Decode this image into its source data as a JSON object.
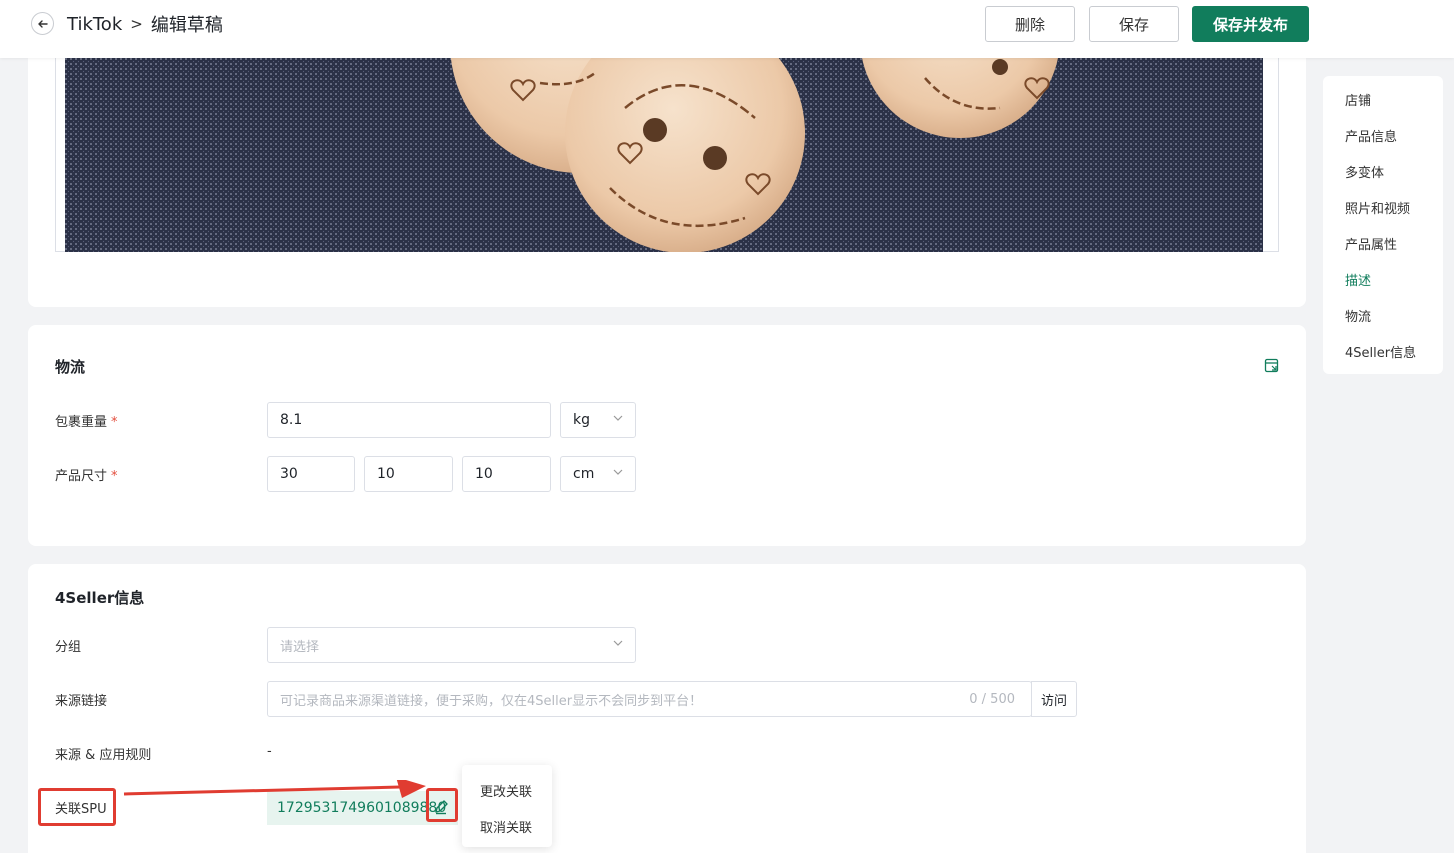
{
  "header": {
    "back_icon": "arrow-left-icon",
    "platform": "TikTok",
    "separator": ">",
    "page_title": "编辑草稿",
    "delete_label": "删除",
    "save_label": "保存",
    "save_publish_label": "保存并发布"
  },
  "logistics": {
    "title": "物流",
    "weight_label": "包裹重量",
    "weight_value": "8.1",
    "weight_unit": "kg",
    "dimension_label": "产品尺寸",
    "length": "30",
    "width": "10",
    "height": "10",
    "dimension_unit": "cm",
    "required_mark": "*"
  },
  "seller_info": {
    "title": "4Seller信息",
    "group_label": "分组",
    "group_placeholder": "请选择",
    "source_link_label": "来源链接",
    "source_link_placeholder": "可记录商品来源渠道链接，便于采购，仅在4Seller显示不会同步到平台！",
    "source_link_count": "0 / 500",
    "visit_label": "访问",
    "source_rule_label": "来源 & 应用规则",
    "source_rule_value": "-",
    "spu_label": "关联SPU",
    "spu_value": "1729531749601089880",
    "spu_menu": [
      "更改关联",
      "取消关联"
    ]
  },
  "side_nav": {
    "items": [
      "店铺",
      "产品信息",
      "多变体",
      "照片和视频",
      "产品属性",
      "描述",
      "物流",
      "4Seller信息"
    ],
    "active_index": 5
  },
  "colors": {
    "primary": "#117d5c",
    "required": "#e34d3d",
    "annotation": "#e03c31"
  }
}
